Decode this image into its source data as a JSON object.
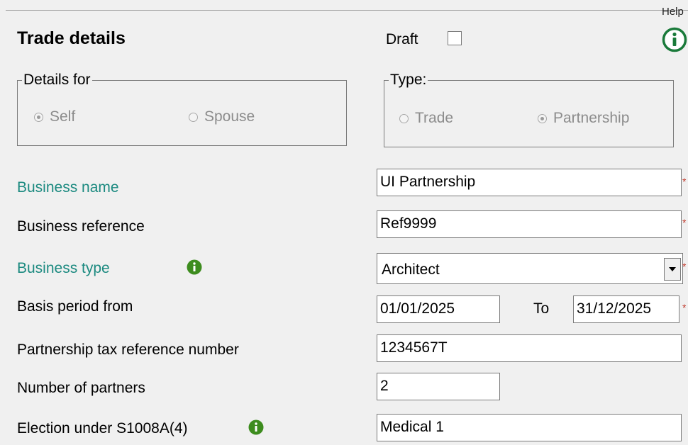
{
  "header": {
    "title": "Trade details",
    "draft_label": "Draft",
    "draft_checked": false,
    "help_label": "Help"
  },
  "details_for": {
    "legend": "Details for",
    "options": [
      {
        "label": "Self",
        "selected": true
      },
      {
        "label": "Spouse",
        "selected": false
      }
    ]
  },
  "type": {
    "legend": "Type:",
    "options": [
      {
        "label": "Trade",
        "selected": false
      },
      {
        "label": "Partnership",
        "selected": true
      }
    ]
  },
  "fields": {
    "business_name": {
      "label": "Business name",
      "value": "UI Partnership"
    },
    "business_reference": {
      "label": "Business reference",
      "value": "Ref9999"
    },
    "business_type": {
      "label": "Business type",
      "value": "Architect"
    },
    "basis_period": {
      "label": "Basis period from",
      "from": "01/01/2025",
      "to_label": "To",
      "to": "31/12/2025"
    },
    "partnership_tax_ref": {
      "label": "Partnership tax reference number",
      "value": "1234567T"
    },
    "number_of_partners": {
      "label": "Number of partners",
      "value": "2"
    },
    "election": {
      "label": "Election under S1008A(4)",
      "value": "Medical 1"
    }
  },
  "colors": {
    "teal_label": "#1c8a80",
    "info_green": "#3d8c1e",
    "help_green": "#1a7a3a"
  }
}
